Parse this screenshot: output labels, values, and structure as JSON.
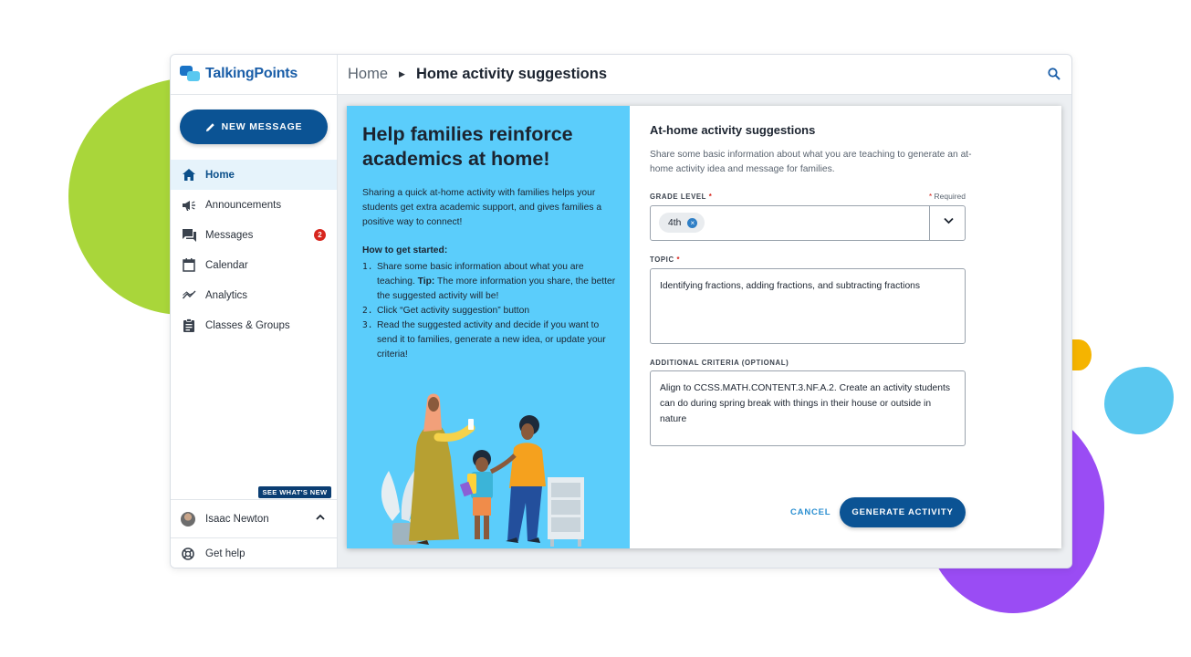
{
  "app": {
    "logo_text": "TalkingPoints"
  },
  "sidebar": {
    "new_message_label": "NEW MESSAGE",
    "items": [
      {
        "label": "Home",
        "icon": "home-icon",
        "active": true
      },
      {
        "label": "Announcements",
        "icon": "megaphone-icon"
      },
      {
        "label": "Messages",
        "icon": "chat-icon",
        "badge": "2"
      },
      {
        "label": "Calendar",
        "icon": "calendar-icon"
      },
      {
        "label": "Analytics",
        "icon": "analytics-icon"
      },
      {
        "label": "Classes & Groups",
        "icon": "clipboard-icon"
      }
    ],
    "see_whats_new": "SEE WHAT'S NEW",
    "user_name": "Isaac Newton",
    "get_help": "Get help"
  },
  "header": {
    "breadcrumb_home": "Home",
    "breadcrumb_current": "Home activity suggestions"
  },
  "promo": {
    "title": "Help families reinforce academics at home!",
    "intro": "Sharing a quick at-home activity with families helps your students get extra academic support, and gives families a positive way to connect!",
    "howto_title": "How to get started:",
    "steps": [
      {
        "num": "1.",
        "before": "Share some basic information about what you are teaching. ",
        "bold": "Tip:",
        "after": " The more information you share, the better the suggested activity will be!"
      },
      {
        "num": "2.",
        "before": "Click “Get activity suggestion” button",
        "bold": "",
        "after": ""
      },
      {
        "num": "3.",
        "before": "Read the suggested activity and decide if you want to send it to families, generate a new idea, or update your criteria!",
        "bold": "",
        "after": ""
      }
    ]
  },
  "form": {
    "title": "At-home activity suggestions",
    "description": "Share some basic information about what you are teaching to generate an at-home activity idea and message for families.",
    "grade_label": "GRADE LEVEL",
    "required_star": "*",
    "required_note": "Required",
    "grade_value": "4th",
    "topic_label": "TOPIC",
    "topic_value": "Identifying fractions, adding fractions, and subtracting fractions",
    "criteria_label": "ADDITIONAL CRITERIA (OPTIONAL)",
    "criteria_value": "Align to CCSS.MATH.CONTENT.3.NF.A.2. Create an activity students can do during spring break with things in their house or outside in nature",
    "cancel_label": "CANCEL",
    "generate_label": "GENERATE ACTIVITY"
  },
  "colors": {
    "brand_blue": "#0b5394",
    "promo_bg": "#5bcdfb",
    "active_nav_bg": "#e6f3fb",
    "badge_red": "#d7261e",
    "blob_green": "#a9d63a",
    "blob_purple": "#9a4cf4",
    "blob_yellow": "#f5b400",
    "blob_cyan": "#5ac8f0"
  }
}
